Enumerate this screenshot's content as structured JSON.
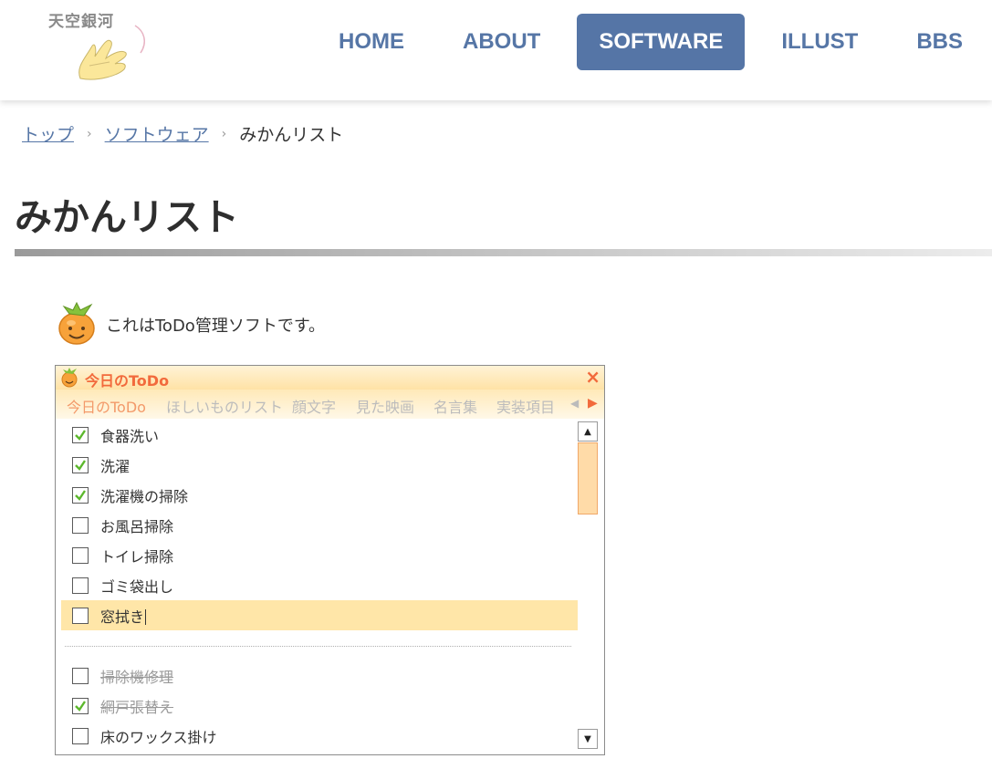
{
  "site": {
    "logo_text": "天空銀河"
  },
  "nav": {
    "items": [
      {
        "label": "HOME"
      },
      {
        "label": "ABOUT"
      },
      {
        "label": "SOFTWARE"
      },
      {
        "label": "ILLUST"
      },
      {
        "label": "BBS"
      }
    ],
    "active": "SOFTWARE"
  },
  "breadcrumb": {
    "items": [
      "トップ",
      "ソフトウェア",
      "みかんリスト"
    ],
    "separator": "›"
  },
  "page": {
    "title": "みかんリスト",
    "intro": "これはToDo管理ソフトです。"
  },
  "app": {
    "title": "今日のToDo",
    "close_icon": "×",
    "tabs": [
      "今日のToDo",
      "ほしいものリスト",
      "顔文字",
      "見た映画",
      "名言集",
      "実装項目"
    ],
    "active_tab": "今日のToDo",
    "tab_prev": "◀",
    "tab_next": "▶",
    "scroll_up": "▲",
    "scroll_down": "▼",
    "items": [
      {
        "label": "食器洗い",
        "checked": true
      },
      {
        "label": "洗濯",
        "checked": true
      },
      {
        "label": "洗濯機の掃除",
        "checked": true
      },
      {
        "label": "お風呂掃除",
        "checked": false
      },
      {
        "label": "トイレ掃除",
        "checked": false
      },
      {
        "label": "ゴミ袋出し",
        "checked": false
      },
      {
        "label": "窓拭き",
        "checked": false,
        "editing": true
      }
    ],
    "lower_items": [
      {
        "label": "掃除機修理",
        "checked": false,
        "struck": true
      },
      {
        "label": "網戸張替え",
        "checked": true,
        "struck": true
      },
      {
        "label": "床のワックス掛け",
        "checked": false
      }
    ]
  },
  "colors": {
    "nav_text": "#5676a6",
    "nav_active_bg": "#5575a6",
    "accent_orange": "#f26a3c",
    "highlight_row": "#ffe6a8",
    "check_green": "#5cb82c"
  }
}
